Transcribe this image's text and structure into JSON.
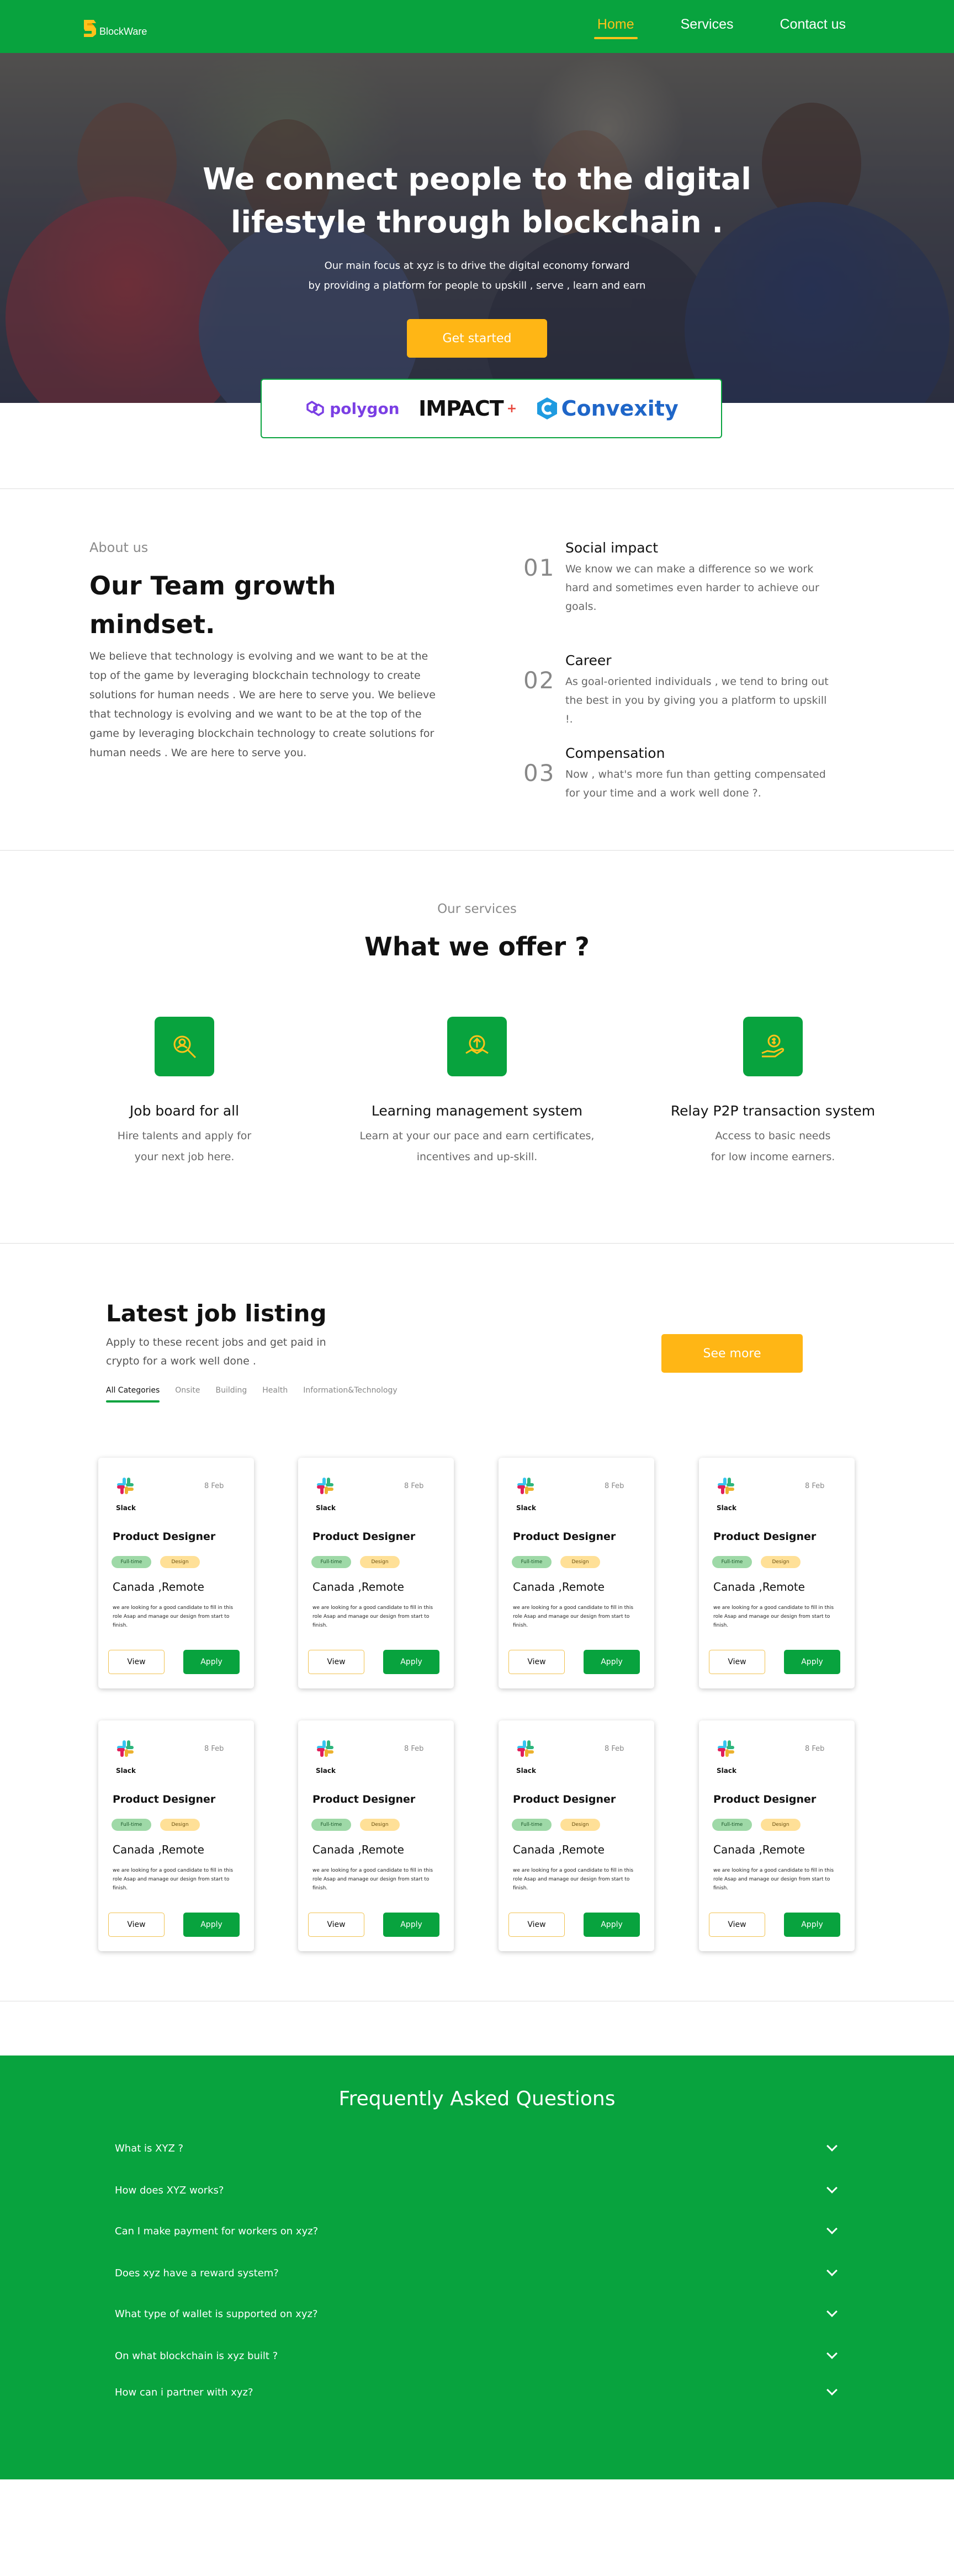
{
  "brand": {
    "name": "BlockWare",
    "color": "#08a33e",
    "accent": "#ffb615"
  },
  "nav": {
    "items": [
      "Home",
      "Services",
      "Contact us"
    ],
    "active": "Home"
  },
  "hero": {
    "title_line1": "We connect people to the digital",
    "title_line2": "lifestyle through blockchain .",
    "sub_line1": "Our main focus at xyz is to drive the digital economy forward",
    "sub_line2": "by providing a platform for people to upskill , serve , learn and earn",
    "cta": "Get started"
  },
  "partners": [
    "polygon",
    "IMPACT",
    "Convexity"
  ],
  "about": {
    "eyebrow": "About us",
    "title": "Our Team growth mindset.",
    "text": "We believe that technology is evolving and we want to be at the top of the game by leveraging blockchain technology to create solutions for human needs . We are here to serve you. We believe that technology is evolving and we want to be at the top of the game by leveraging blockchain technology to create solutions for human needs . We are here to serve you.",
    "features": [
      {
        "num": "01",
        "title": "Social impact",
        "desc": "We know we can make a difference so we work hard and sometimes even harder to achieve our goals."
      },
      {
        "num": "02",
        "title": "Career",
        "desc": "As goal-oriented individuals , we tend to bring out the best in you by giving you a platform to upskill !."
      },
      {
        "num": "03",
        "title": "Compensation",
        "desc": "Now , what's more fun than getting compensated for your time and a work well done ?."
      }
    ]
  },
  "services": {
    "eyebrow": "Our services",
    "title": "What we offer ?",
    "items": [
      {
        "icon": "job-search-icon",
        "name": "Job board for all",
        "line1": "Hire talents and apply for",
        "line2": "your next job here."
      },
      {
        "icon": "learning-icon",
        "name": "Learning management system",
        "line1": "Learn at your our pace and earn certificates,",
        "line2": "incentives and up-skill."
      },
      {
        "icon": "money-hand-icon",
        "name": "Relay P2P transaction system",
        "line1": "Access to basic needs",
        "line2": "for low income earners."
      }
    ]
  },
  "jobs": {
    "title": "Latest job listing",
    "sub": "Apply  to these recent jobs and get paid in crypto for a work well done .",
    "more": "See more",
    "tabs": [
      "All Categories",
      "Onsite",
      "Building",
      "Health",
      "Information&Technology"
    ],
    "active_tab": "All Categories",
    "cards": [
      {
        "company": "Slack",
        "date": "8 Feb",
        "title": "Product Designer",
        "tag1": "Full-time",
        "tag2": "Design",
        "location": "Canada ,Remote",
        "desc": "we are looking for a good candidate to fill in this role Asap and manage our design from start to finish.",
        "view": "View",
        "apply": "Apply"
      },
      {
        "company": "Slack",
        "date": "8 Feb",
        "title": "Product Designer",
        "tag1": "Full-time",
        "tag2": "Design",
        "location": "Canada ,Remote",
        "desc": "we are looking for a good candidate to fill in this role Asap and manage our design from start to finish.",
        "view": "View",
        "apply": "Apply"
      },
      {
        "company": "Slack",
        "date": "8 Feb",
        "title": "Product Designer",
        "tag1": "Full-time",
        "tag2": "Design",
        "location": "Canada ,Remote",
        "desc": "we are looking for a good candidate to fill in this role Asap and manage our design from start to finish.",
        "view": "View",
        "apply": "Apply"
      },
      {
        "company": "Slack",
        "date": "8 Feb",
        "title": "Product Designer",
        "tag1": "Full-time",
        "tag2": "Design",
        "location": "Canada ,Remote",
        "desc": "we are looking for a good candidate to fill in this role Asap and manage our design from start to finish.",
        "view": "View",
        "apply": "Apply"
      },
      {
        "company": "Slack",
        "date": "8 Feb",
        "title": "Product Designer",
        "tag1": "Full-time",
        "tag2": "Design",
        "location": "Canada ,Remote",
        "desc": "we are looking for a good candidate to fill in this role Asap and manage our design from start to finish.",
        "view": "View",
        "apply": "Apply"
      },
      {
        "company": "Slack",
        "date": "8 Feb",
        "title": "Product Designer",
        "tag1": "Full-time",
        "tag2": "Design",
        "location": "Canada ,Remote",
        "desc": "we are looking for a good candidate to fill in this role Asap and manage our design from start to finish.",
        "view": "View",
        "apply": "Apply"
      },
      {
        "company": "Slack",
        "date": "8 Feb",
        "title": "Product Designer",
        "tag1": "Full-time",
        "tag2": "Design",
        "location": "Canada ,Remote",
        "desc": "we are looking for a good candidate to fill in this role Asap and manage our design from start to finish.",
        "view": "View",
        "apply": "Apply"
      },
      {
        "company": "Slack",
        "date": "8 Feb",
        "title": "Product Designer",
        "tag1": "Full-time",
        "tag2": "Design",
        "location": "Canada ,Remote",
        "desc": "we are looking for a good candidate to fill in this role Asap and manage our design from start to finish.",
        "view": "View",
        "apply": "Apply"
      }
    ]
  },
  "faq": {
    "title": "Frequently Asked Questions",
    "items": [
      "What is XYZ ?",
      "How does XYZ works?",
      "Can I make  payment for workers on xyz?",
      "Does xyz have a reward system?",
      "What type of  wallet is supported on xyz?",
      "On what blockchain is xyz built ?",
      "How can i partner with xyz?"
    ]
  }
}
